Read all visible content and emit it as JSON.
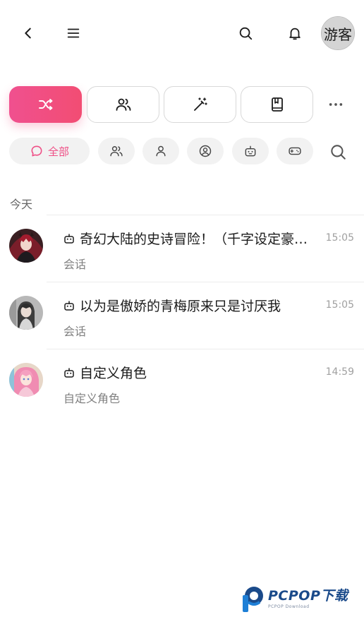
{
  "topbar": {
    "guest_label": "游客"
  },
  "filters": {
    "all_label": "全部"
  },
  "section": {
    "today_label": "今天"
  },
  "conversations": [
    {
      "title": "奇幻大陆的史诗冒险！（千字设定豪…",
      "subtitle": "会话",
      "time": "15:05"
    },
    {
      "title": "以为是傲娇的青梅原来只是讨厌我",
      "subtitle": "会话",
      "time": "15:05"
    },
    {
      "title": "自定义角色",
      "subtitle": "自定义角色",
      "time": "14:59"
    }
  ],
  "watermark": {
    "brand": "PCPOP下载",
    "sub": "PCPOP Download"
  },
  "colors": {
    "accent": "#ef4f86",
    "chip_bg": "#f2f2f2"
  }
}
